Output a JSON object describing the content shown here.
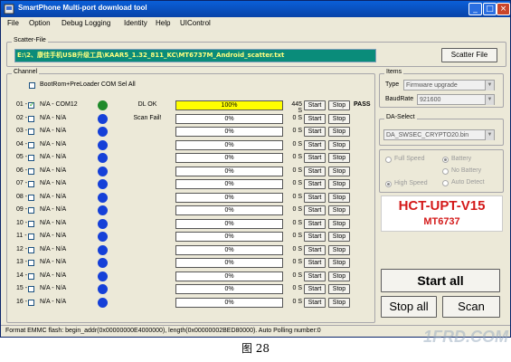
{
  "window": {
    "title": "SmartPhone Multi-port download tool",
    "minimize": "_",
    "maximize": "□",
    "close": "×"
  },
  "menu": [
    "File",
    "Option",
    "Debug Logging",
    "Identity",
    "Help",
    "UIControl"
  ],
  "scatter": {
    "label": "Scatter-File",
    "path": "E:\\2、康佳手机USB升级工具\\KAAR5_1.32_811_KC\\MT6737M_Android_scatter.txt",
    "button": "Scatter File"
  },
  "channel": {
    "label": "Channel",
    "select_all": "BootRom+PreLoader COM Sel All",
    "start_label": "Start",
    "stop_label": "Stop",
    "rows": [
      {
        "num": "01 -",
        "checked": true,
        "port": "N/A - COM12",
        "dot": "green",
        "status": "DL OK",
        "progress": 1.0,
        "pct": "100%",
        "time": "445 S",
        "result": "PASS"
      },
      {
        "num": "02 -",
        "checked": false,
        "port": "N/A - N/A",
        "dot": "blue",
        "status": "Scan Fail!",
        "progress": 0,
        "pct": "0%",
        "time": "0 S",
        "result": ""
      },
      {
        "num": "03 -",
        "checked": false,
        "port": "N/A - N/A",
        "dot": "blue",
        "status": "",
        "progress": 0,
        "pct": "0%",
        "time": "0 S",
        "result": ""
      },
      {
        "num": "04 -",
        "checked": false,
        "port": "N/A - N/A",
        "dot": "blue",
        "status": "",
        "progress": 0,
        "pct": "0%",
        "time": "0 S",
        "result": ""
      },
      {
        "num": "05 -",
        "checked": false,
        "port": "N/A - N/A",
        "dot": "blue",
        "status": "",
        "progress": 0,
        "pct": "0%",
        "time": "0 S",
        "result": ""
      },
      {
        "num": "06 -",
        "checked": false,
        "port": "N/A - N/A",
        "dot": "blue",
        "status": "",
        "progress": 0,
        "pct": "0%",
        "time": "0 S",
        "result": ""
      },
      {
        "num": "07 -",
        "checked": false,
        "port": "N/A - N/A",
        "dot": "blue",
        "status": "",
        "progress": 0,
        "pct": "0%",
        "time": "0 S",
        "result": ""
      },
      {
        "num": "08 -",
        "checked": false,
        "port": "N/A - N/A",
        "dot": "blue",
        "status": "",
        "progress": 0,
        "pct": "0%",
        "time": "0 S",
        "result": ""
      },
      {
        "num": "09 -",
        "checked": false,
        "port": "N/A - N/A",
        "dot": "blue",
        "status": "",
        "progress": 0,
        "pct": "0%",
        "time": "0 S",
        "result": ""
      },
      {
        "num": "10 -",
        "checked": false,
        "port": "N/A - N/A",
        "dot": "blue",
        "status": "",
        "progress": 0,
        "pct": "0%",
        "time": "0 S",
        "result": ""
      },
      {
        "num": "11 -",
        "checked": false,
        "port": "N/A - N/A",
        "dot": "blue",
        "status": "",
        "progress": 0,
        "pct": "0%",
        "time": "0 S",
        "result": ""
      },
      {
        "num": "12 -",
        "checked": false,
        "port": "N/A - N/A",
        "dot": "blue",
        "status": "",
        "progress": 0,
        "pct": "0%",
        "time": "0 S",
        "result": ""
      },
      {
        "num": "13 -",
        "checked": false,
        "port": "N/A - N/A",
        "dot": "blue",
        "status": "",
        "progress": 0,
        "pct": "0%",
        "time": "0 S",
        "result": ""
      },
      {
        "num": "14 -",
        "checked": false,
        "port": "N/A - N/A",
        "dot": "blue",
        "status": "",
        "progress": 0,
        "pct": "0%",
        "time": "0 S",
        "result": ""
      },
      {
        "num": "15 -",
        "checked": false,
        "port": "N/A - N/A",
        "dot": "blue",
        "status": "",
        "progress": 0,
        "pct": "0%",
        "time": "0 S",
        "result": ""
      },
      {
        "num": "16 -",
        "checked": false,
        "port": "N/A - N/A",
        "dot": "blue",
        "status": "",
        "progress": 0,
        "pct": "0%",
        "time": "0 S",
        "result": ""
      }
    ]
  },
  "items": {
    "label": "Items",
    "type_label": "Type",
    "type_value": "Firmware upgrade",
    "baud_label": "BaudRate",
    "baud_value": "921600"
  },
  "da": {
    "label": "DA-Select",
    "value": "DA_SWSEC_CRYPTO20.bin"
  },
  "options": {
    "full_speed": "Full Speed",
    "high_speed": "High Speed",
    "battery": "Battery",
    "no_battery": "No Battery",
    "auto_detect": "Auto Detect"
  },
  "brand": {
    "line1": "HCT-UPT-V15",
    "line2": "MT6737"
  },
  "actions": {
    "start_all": "Start all",
    "stop_all": "Stop all",
    "scan": "Scan"
  },
  "status_bar": "Format EMMC flash:  begin_addr(0x00000000E4000000), length(0x00000002BED80000). Auto Polling number:0",
  "caption": "图 28",
  "watermark": "1FRD.COM",
  "colors": {
    "dot_green": "#1f8a2a",
    "dot_blue": "#1540d8",
    "progress_fill": "#ffff00",
    "brand_red": "#d41a1a",
    "scatter_bg": "#0a8c7a"
  }
}
